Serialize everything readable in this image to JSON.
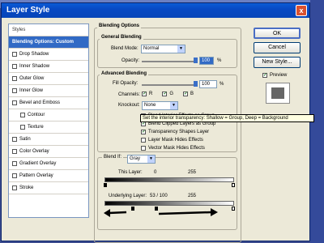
{
  "window": {
    "title": "Layer Style",
    "close_glyph": "x"
  },
  "sidebar": {
    "items": [
      {
        "label": "Styles",
        "type": "header"
      },
      {
        "label": "Blending Options: Custom",
        "type": "selected"
      },
      {
        "label": "Drop Shadow"
      },
      {
        "label": "Inner Shadow"
      },
      {
        "label": "Outer Glow"
      },
      {
        "label": "Inner Glow"
      },
      {
        "label": "Bevel and Emboss"
      },
      {
        "label": "Contour",
        "indent": true
      },
      {
        "label": "Texture",
        "indent": true
      },
      {
        "label": "Satin"
      },
      {
        "label": "Color Overlay"
      },
      {
        "label": "Gradient Overlay"
      },
      {
        "label": "Pattern Overlay"
      },
      {
        "label": "Stroke"
      }
    ]
  },
  "blending": {
    "section_title": "Blending Options",
    "general_title": "General Blending",
    "blend_mode_label": "Blend Mode:",
    "blend_mode_value": "Normal",
    "opacity_label": "Opacity:",
    "opacity_value": "100",
    "percent": "%"
  },
  "advanced": {
    "title": "Advanced Blending",
    "fill_opacity_label": "Fill Opacity:",
    "fill_opacity_value": "100",
    "percent": "%",
    "channels_label": "Channels:",
    "channels": [
      "R",
      "G",
      "B"
    ],
    "knockout_label": "Knockout:",
    "knockout_value": "None",
    "options": [
      {
        "label": "Blend Interior Effects as Group",
        "checked": false
      },
      {
        "label": "Blend Clipped Layers as Group",
        "checked": true
      },
      {
        "label": "Transparency Shapes Layer",
        "checked": true
      },
      {
        "label": "Layer Mask Hides Effects",
        "checked": false
      },
      {
        "label": "Vector Mask Hides Effects",
        "checked": false
      }
    ]
  },
  "tooltip": "Set the interior transparency: Shallow = Group, Deep = Background",
  "blend_if": {
    "label": "Blend If:",
    "value": "Gray",
    "this_layer_label": "This Layer:",
    "this_layer_min": "0",
    "this_layer_max": "255",
    "underlying_label": "Underlying Layer:",
    "underlying_values": "53  /  100",
    "underlying_max": "255"
  },
  "buttons": {
    "ok": "OK",
    "cancel": "Cancel",
    "new_style": "New Style...",
    "preview": "Preview"
  }
}
